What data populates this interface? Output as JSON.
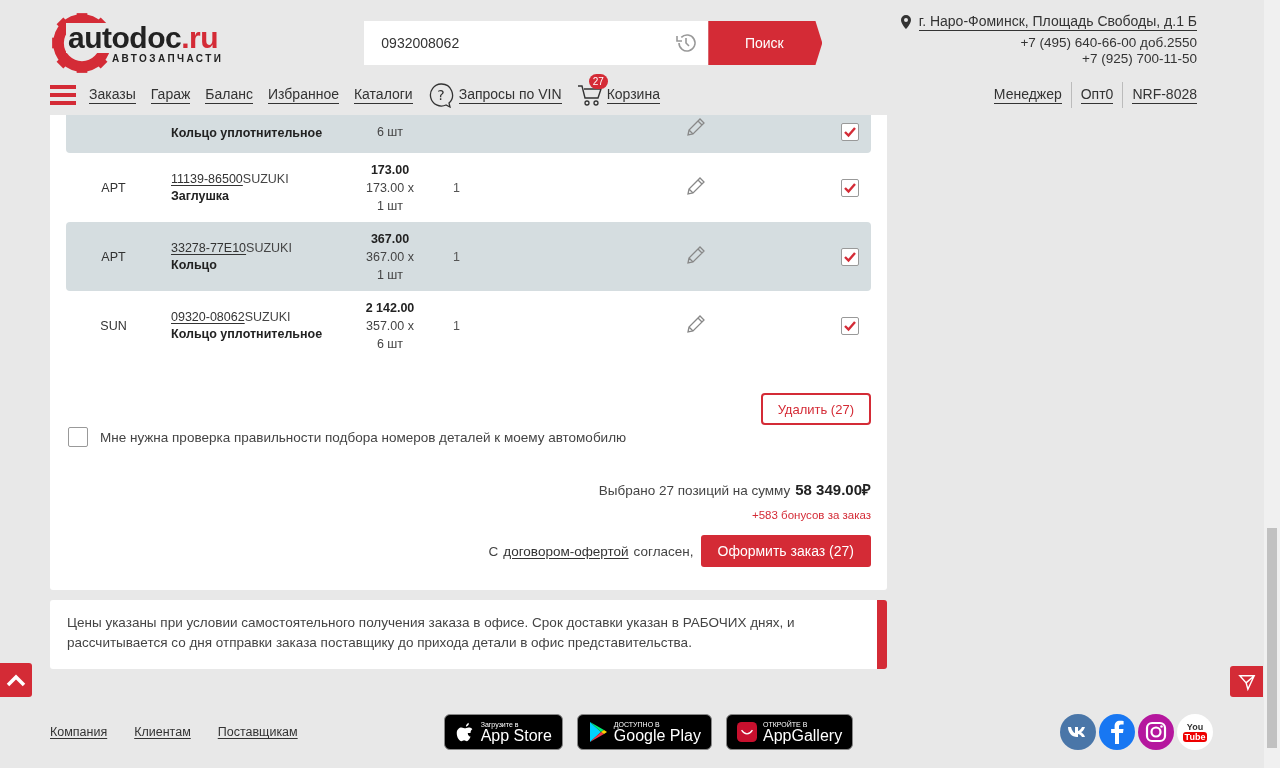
{
  "header": {
    "logo_text": "autodoc",
    "logo_domain": ".ru",
    "logo_tagline": "АВТОЗАПЧАСТИ",
    "search": {
      "value": "0932008062",
      "button": "Поиск"
    },
    "address": "г. Наро-Фоминск, Площадь Свободы, д.1 Б",
    "phones": [
      "+7 (495) 640-66-00 доб.2550",
      "+7 (925) 700-11-50"
    ],
    "nav": [
      {
        "label": "Заказы",
        "kind": "link"
      },
      {
        "label": "Гараж",
        "kind": "link"
      },
      {
        "label": "Баланс",
        "kind": "link"
      },
      {
        "label": "Избранное",
        "kind": "link"
      },
      {
        "label": "Каталоги",
        "kind": "link"
      },
      {
        "label": "Запросы по VIN",
        "kind": "vin",
        "icon": "?"
      },
      {
        "label": "Корзина",
        "kind": "cart",
        "badge": "27"
      }
    ],
    "user_links": [
      "Менеджер",
      "Опт0",
      "NRF-8028"
    ]
  },
  "rows": [
    {
      "name": "Кольцо уплотнительное",
      "unit": "6 шт",
      "checked": true,
      "clipped": true
    },
    {
      "brand": "APT",
      "number": "11139-86500",
      "maker": "SUZUKI",
      "name": "Заглушка",
      "total": "173.00",
      "price": "173.00 x",
      "unit": "1 шт",
      "days": "1",
      "checked": true
    },
    {
      "brand": "APT",
      "number": "33278-77E10",
      "maker": "SUZUKI",
      "name": "Кольцо",
      "total": "367.00",
      "price": "367.00 x",
      "unit": "1 шт",
      "days": "1",
      "checked": true
    },
    {
      "brand": "SUN",
      "number": "09320-08062",
      "maker": "SUZUKI",
      "name": "Кольцо уплотнительное",
      "total": "2 142.00",
      "price": "357.00 x",
      "unit": "6 шт",
      "days": "1",
      "checked": true
    }
  ],
  "delete_button": "Удалить (27)",
  "verify": {
    "label": "Мне нужна проверка правильности подбора номеров деталей к моему автомобилю",
    "checked": false
  },
  "summary": {
    "text": "Выбрано 27 позиций на сумму",
    "amount": "58 349.00₽",
    "bonus": "+583 бонусов за заказ"
  },
  "agreement": {
    "prefix": "С",
    "link": "договором-офертой",
    "suffix": "согласен,",
    "button": "Оформить заказ (27)"
  },
  "notice": "Цены указаны при условии самостоятельного получения заказа в офисе. Срок доставки указан в РАБОЧИХ днях, и рассчитывается со дня отправки заказа поставщику до прихода детали в офис представительства.",
  "footer": {
    "links": [
      "Компания",
      "Клиентам",
      "Поставщикам"
    ],
    "stores": [
      {
        "small": "Загрузите в",
        "big": "App Store",
        "kind": "apple"
      },
      {
        "small": "ДОСТУПНО В",
        "big": "Google Play",
        "kind": "google"
      },
      {
        "small": "ОТКРОЙТЕ В",
        "big": "AppGallery",
        "kind": "huawei"
      }
    ],
    "social": [
      {
        "kind": "vk"
      },
      {
        "kind": "facebook"
      },
      {
        "kind": "instagram"
      },
      {
        "kind": "youtube",
        "label": "You",
        "label2": "Tube"
      }
    ]
  }
}
